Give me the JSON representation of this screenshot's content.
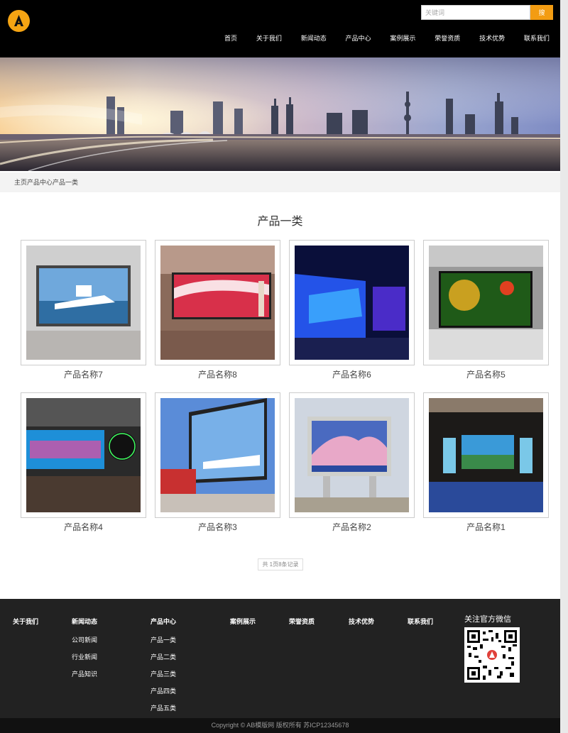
{
  "header": {
    "logo_icon": "A-logo-icon",
    "search": {
      "placeholder": "关键词",
      "button_label": "搜"
    },
    "nav": [
      "首页",
      "关于我们",
      "新闻动态",
      "产品中心",
      "案例展示",
      "荣誉资质",
      "技术优势",
      "联系我们"
    ]
  },
  "breadcrumb": "主页产品中心产品一类",
  "section_title": "产品一类",
  "products": [
    {
      "label": "产品名称7"
    },
    {
      "label": "产品名称8"
    },
    {
      "label": "产品名称6"
    },
    {
      "label": "产品名称5"
    },
    {
      "label": "产品名称4"
    },
    {
      "label": "产品名称3"
    },
    {
      "label": "产品名称2"
    },
    {
      "label": "产品名称1"
    }
  ],
  "pager": "共 1页8条记录",
  "footer": {
    "columns": [
      {
        "title": "关于我们",
        "links": []
      },
      {
        "title": "新闻动态",
        "links": [
          "公司新闻",
          "行业新闻",
          "产品知识"
        ]
      },
      {
        "title": "产品中心",
        "links": [
          "产品一类",
          "产品二类",
          "产品三类",
          "产品四类",
          "产品五类"
        ]
      },
      {
        "title": "案例展示",
        "links": []
      },
      {
        "title": "荣誉资质",
        "links": []
      },
      {
        "title": "技术优势",
        "links": []
      },
      {
        "title": "联系我们",
        "links": []
      }
    ],
    "wechat_title": "关注官方微信",
    "copyright": "Copyright © AB模版网 版权所有    苏ICP12345678"
  },
  "colors": {
    "accent": "#f39c12",
    "header_bg": "#000000",
    "footer_bg": "#222222"
  }
}
